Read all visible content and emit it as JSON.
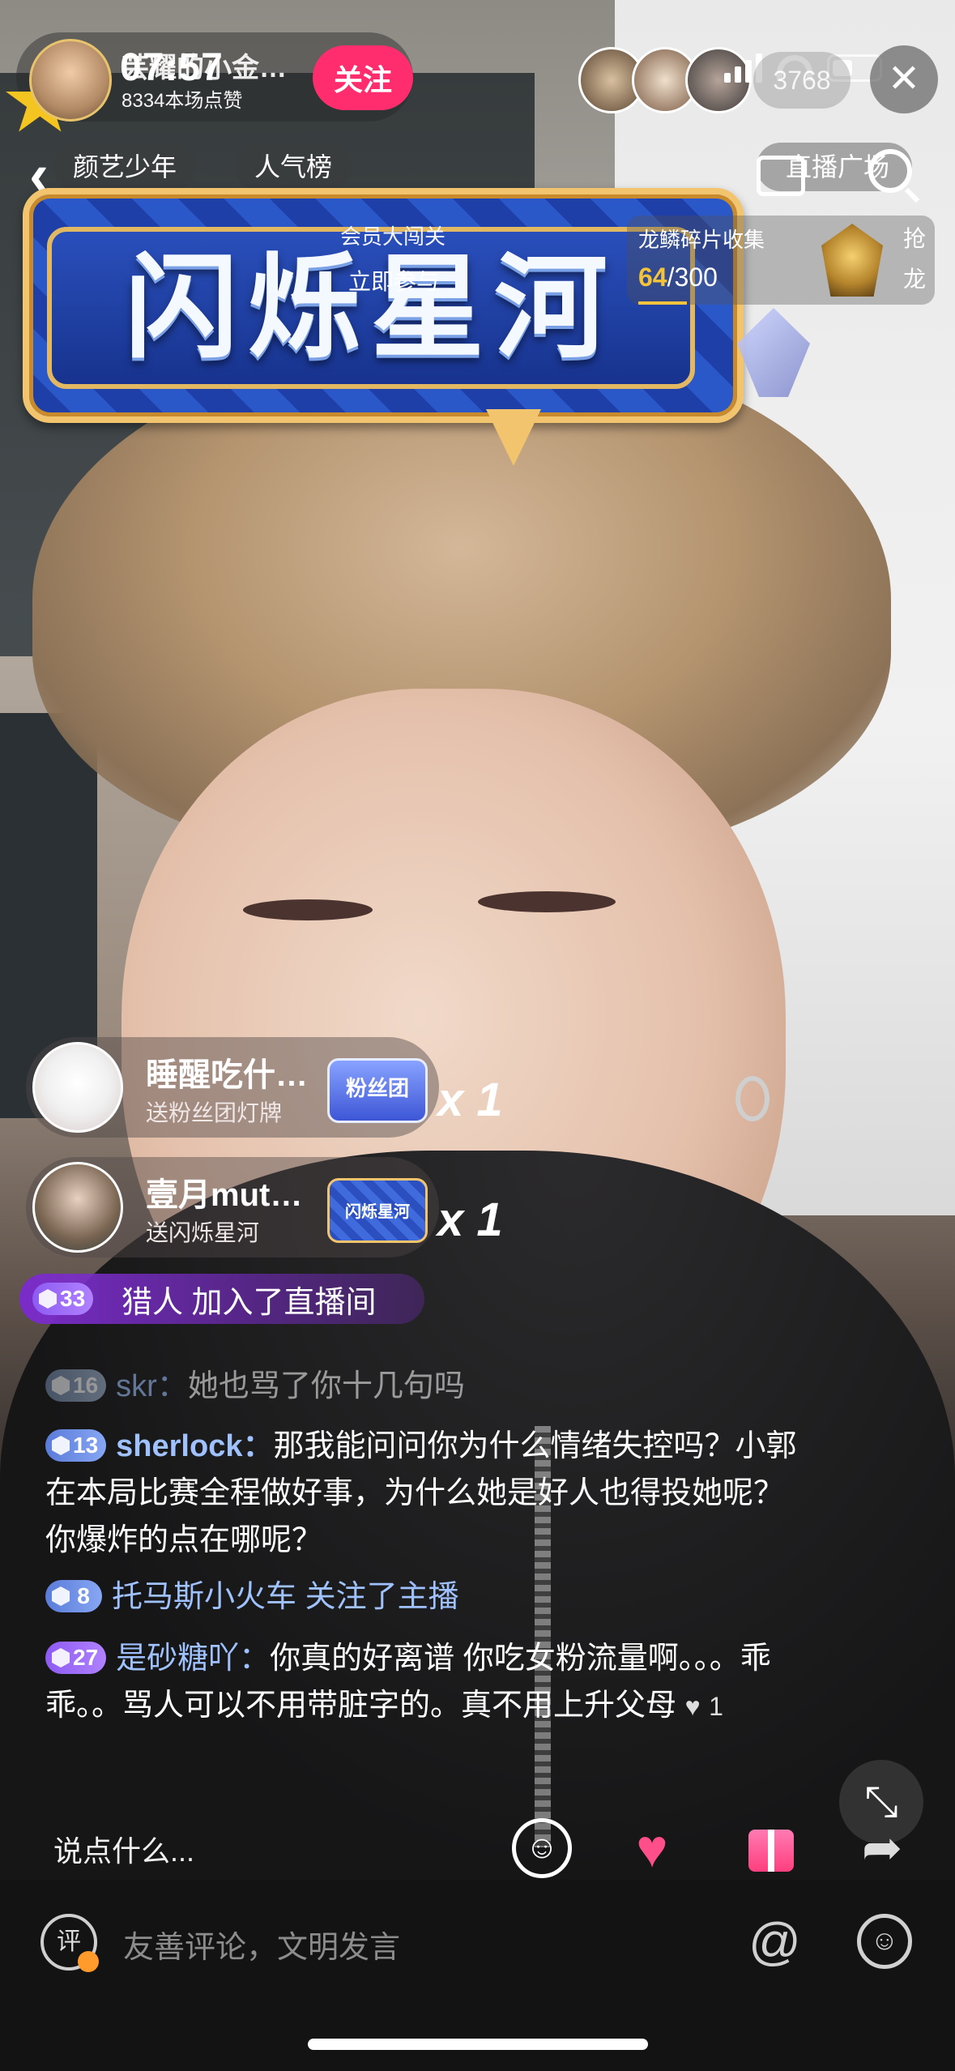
{
  "status_bar": {
    "time": "07:57"
  },
  "host": {
    "name": "芸耀的小金…",
    "likes": "8334本场点赞",
    "follow_label": "关注"
  },
  "viewers": {
    "count": "3768"
  },
  "nav": {
    "chip_1": "颜艺少年",
    "chip_2": "人气榜",
    "chip_3": "直播广场"
  },
  "banner": {
    "title": "闪烁星河",
    "member_card": "会员大闯关",
    "member_join": "立即参与",
    "dragon_title": "龙鳞碎片收集",
    "dragon_current": "64",
    "dragon_total": "/300",
    "grab_label": "抢龙"
  },
  "gifts": [
    {
      "name": "睡醒吃什…",
      "desc": "送粉丝团灯牌",
      "image_label": "粉丝团",
      "mult": "x 1"
    },
    {
      "name": "壹月mut…",
      "desc": "送闪烁星河",
      "image_label": "闪烁星河",
      "mult": "x 1"
    }
  ],
  "join": {
    "level": "33",
    "text": "猎人 加入了直播间"
  },
  "chat": [
    {
      "level": "16",
      "user": "skr：",
      "text": "她也骂了你十几句吗"
    },
    {
      "level": "13",
      "user": "sherlock：",
      "text": "那我能问问你为什么情绪失控吗？小郭在本局比赛全程做好事，为什么她是好人也得投她呢？你爆炸的点在哪呢？"
    },
    {
      "level": "8",
      "user": "托马斯小火车",
      "text": "关注了主播"
    },
    {
      "level": "27",
      "user": "是砂糖吖：",
      "text": "你真的好离谱 你吃女粉流量啊。。。乖乖。。骂人可以不用带脏字的。真不用上升父母",
      "likes": "1"
    }
  ],
  "bottom": {
    "say_placeholder": "说点什么...",
    "comment_placeholder": "友善评论，文明发言",
    "comment_avatar": "评"
  },
  "colors": {
    "follow": "#ff2d6e",
    "username": "#9fc2ff",
    "dragon_progress": "#f3c43b"
  },
  "icons": [
    "back-arrow-icon",
    "close-icon",
    "search-icon",
    "tv-icon",
    "emoji-icon",
    "heart-icon",
    "gift-icon",
    "share-icon",
    "collapse-icon",
    "at-icon",
    "smile-icon"
  ]
}
